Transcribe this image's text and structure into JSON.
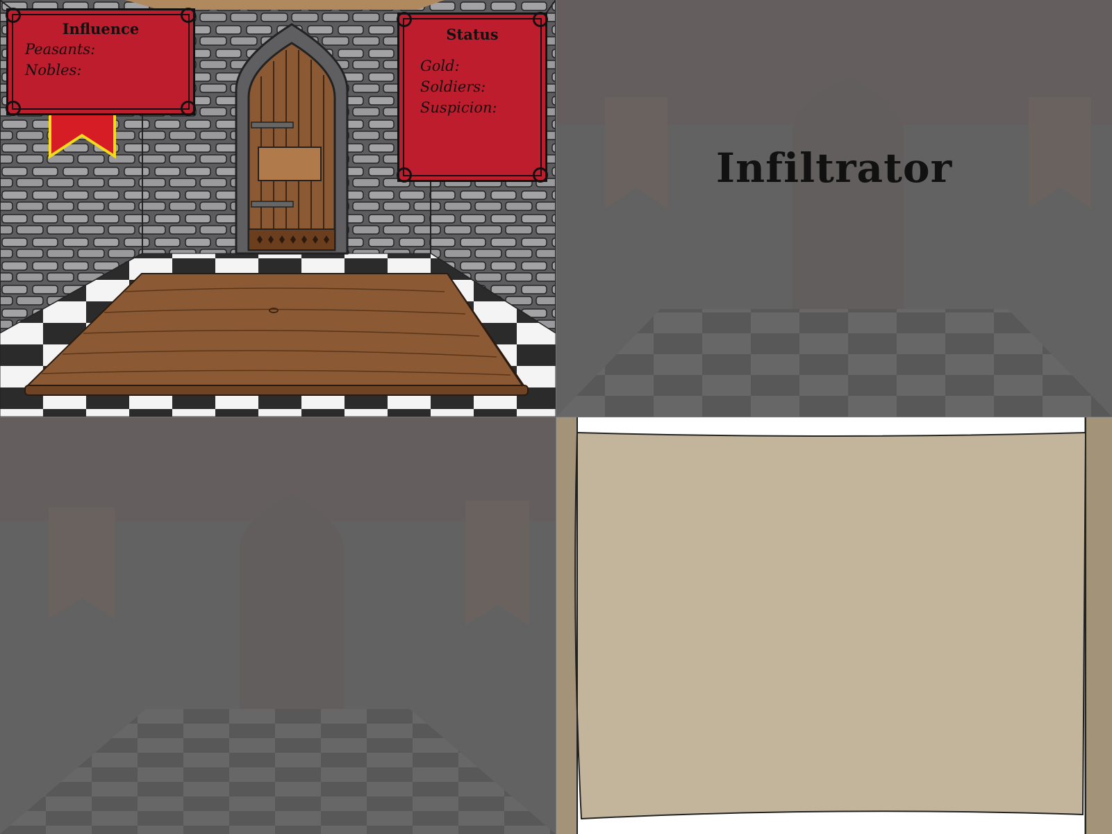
{
  "game_title": "Infiltrator",
  "influence_panel": {
    "title": "Influence",
    "peasants_label": "Peasants:",
    "nobles_label": "Nobles:"
  },
  "status_panel": {
    "title": "Status",
    "gold_label": "Gold:",
    "soldiers_label": "Soldiers:",
    "suspicion_label": "Suspicion:"
  },
  "colors": {
    "panel_red": "#be1d2d",
    "parchment": "#c2b59b",
    "wood": "#8b5a34",
    "stone": "#8f8f92"
  }
}
